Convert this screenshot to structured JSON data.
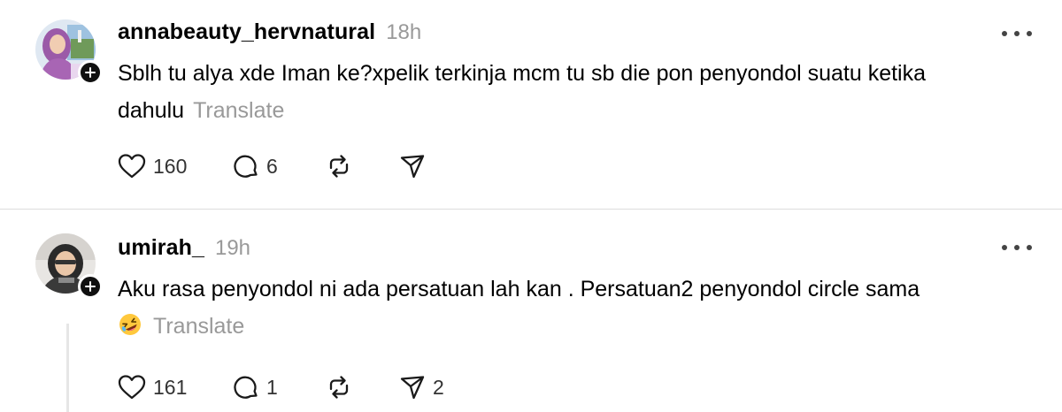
{
  "posts": [
    {
      "username": "annabeauty_hervnatural",
      "time": "18h",
      "text": "Sblh tu alya xde Iman ke?xpelik terkinja mcm tu sb die pon penyondol suatu ketika dahulu",
      "translate_label": "Translate",
      "likes": "160",
      "replies": "6",
      "reposts": "",
      "shares": ""
    },
    {
      "username": "umirah_",
      "time": "19h",
      "text": "Aku rasa penyondol ni ada persatuan lah kan . Persatuan2 penyondol circle sama",
      "translate_label": "Translate",
      "likes": "161",
      "replies": "1",
      "reposts": "",
      "shares": "2"
    }
  ],
  "icons": {
    "like": "heart-icon",
    "reply": "comment-icon",
    "repost": "repost-icon",
    "share": "send-icon",
    "more": "more-icon",
    "follow": "plus-icon",
    "emoji": "rolling-laughing-emoji-icon"
  },
  "colors": {
    "text": "#000000",
    "muted": "#999999",
    "divider": "#dcdcdc"
  }
}
